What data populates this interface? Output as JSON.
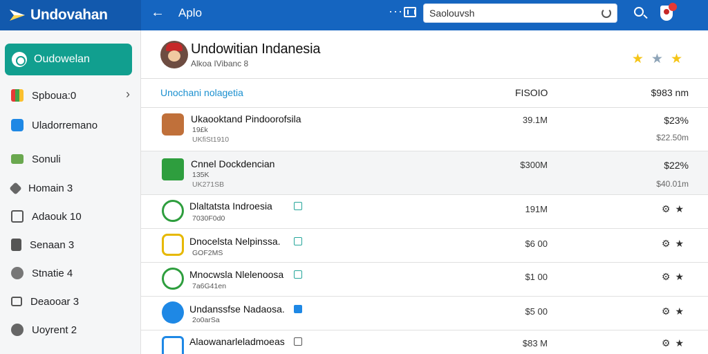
{
  "app": {
    "brand_name": "Undovahan",
    "back_icon": "arrow-left-icon",
    "page_title": "Aplo",
    "search": {
      "value": "Saolouvsh",
      "placeholder": ""
    },
    "icons": [
      "more-dots-icon",
      "window-icon",
      "refresh-icon",
      "search-icon",
      "shield-icon"
    ],
    "colors": {
      "topbar": "#1565c0",
      "brand_bg": "#1259ad",
      "active_nav": "#119f8f",
      "header_link": "#1a8fcf"
    }
  },
  "sidebar": {
    "active": {
      "label": "Oudowelan",
      "icon": "circle-icon"
    },
    "items": [
      {
        "label": "Spboua:0",
        "icon": "colored-bars-icon",
        "has_chevron": true
      },
      {
        "label": "Uladorremano",
        "icon": "blue-square-icon"
      },
      {
        "label": "Sonuli",
        "icon": "folder-icon"
      },
      {
        "label": "Homain 3",
        "icon": "tag-icon"
      },
      {
        "label": "Adaouk 10",
        "icon": "camera-icon"
      },
      {
        "label": "Senaan 3",
        "icon": "document-icon"
      },
      {
        "label": "Stnatie 4",
        "icon": "clock-icon"
      },
      {
        "label": "Deaooar 3",
        "icon": "box-icon"
      },
      {
        "label": "Uoyrent 2",
        "icon": "info-icon"
      }
    ]
  },
  "header": {
    "title": "Undowitian Indanesia",
    "subtitle": "Alkoa IVibanc 8",
    "rating": {
      "gold_stars": 2,
      "gray_stars": 1
    }
  },
  "table": {
    "columns": {
      "name": "Unochani nolagetia",
      "size": "FISOIO",
      "price": "$983 nm"
    },
    "rows_tall": [
      {
        "name": "Ukaooktand Pindoorofsila",
        "line2": "19£k",
        "line3": "UKfiSt1910",
        "size": "39.1M",
        "price": "$23%",
        "sub": "$22.50m",
        "highlight": false,
        "icon_color": "#c0703a"
      },
      {
        "name": "Cnnel Dockdencian",
        "line2": "135K",
        "line3": "UK271SB",
        "size": "$300M",
        "price": "$22%",
        "sub": "$40.01m",
        "highlight": true,
        "icon_color": "#2e9e3e"
      }
    ],
    "rows_short": [
      {
        "name": "Dlaltatsta Indroesia",
        "line2": "7030F0d0",
        "size": "191M",
        "tag_color": "#25a69a",
        "icon_color": "#2e9e3e"
      },
      {
        "name": "Dnocelsta Nelpinssa.",
        "line2": "GOF2MS",
        "size": "$6 00",
        "tag_color": "#25a69a",
        "icon_color": "#e6b800"
      },
      {
        "name": "Mnocwsla Nlelenoosa",
        "line2": "7a6G41en",
        "size": "$1 00",
        "tag_color": "#25a69a",
        "icon_color": "#2e9e3e"
      },
      {
        "name": "Undanssfse Nadaosa.",
        "line2": "2o0arSa",
        "size": "$5 00",
        "tag_color": "#1e88e5",
        "icon_color": "#1e88e5"
      },
      {
        "name": "Alaowanarleladmoeas",
        "line2": "",
        "size": "$83 M",
        "tag_color": "#555555",
        "icon_color": "#1e88e5"
      }
    ],
    "row_action_icons": [
      "settings-icon",
      "star-icon"
    ]
  }
}
